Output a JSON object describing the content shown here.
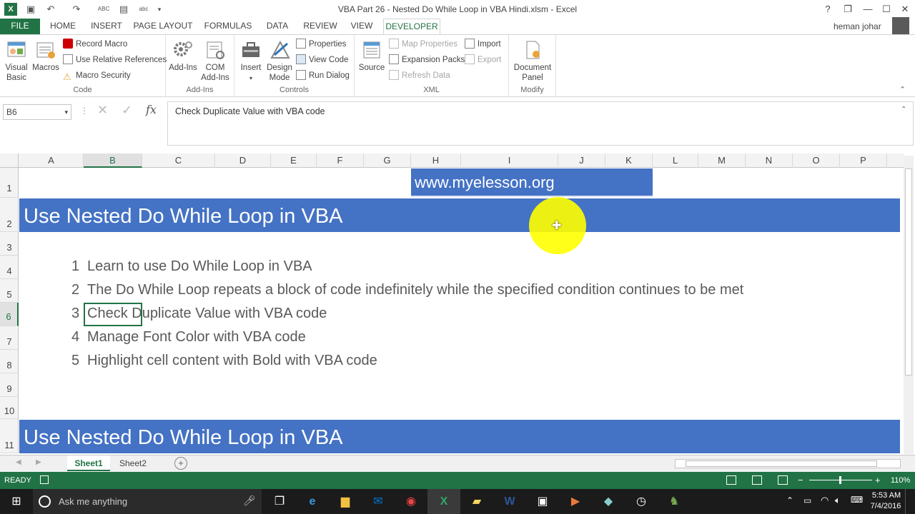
{
  "window": {
    "title": "VBA Part 26 -  Nested Do While Loop in VBA Hindi.xlsm - Excel",
    "help": "?",
    "restore": "❐",
    "minimize": "—",
    "maximize": "☐",
    "close": "✕",
    "user": "heman johar"
  },
  "ribbon_tabs": [
    {
      "label": "FILE"
    },
    {
      "label": "HOME"
    },
    {
      "label": "INSERT"
    },
    {
      "label": "PAGE LAYOUT"
    },
    {
      "label": "FORMULAS"
    },
    {
      "label": "DATA"
    },
    {
      "label": "REVIEW"
    },
    {
      "label": "VIEW"
    },
    {
      "label": "DEVELOPER"
    }
  ],
  "ribbon": {
    "code": {
      "label": "Code",
      "visual_basic": "Visual\nBasic",
      "macros": "Macros",
      "record_macro": "Record Macro",
      "relative_refs": "Use Relative References",
      "macro_security": "Macro Security"
    },
    "addins": {
      "label": "Add-Ins",
      "add_ins": "Add-Ins",
      "com_add_ins": "COM\nAdd-Ins"
    },
    "controls": {
      "label": "Controls",
      "insert": "Insert",
      "design_mode": "Design\nMode",
      "properties": "Properties",
      "view_code": "View Code",
      "run_dialog": "Run Dialog"
    },
    "xml": {
      "label": "XML",
      "source": "Source",
      "map_properties": "Map Properties",
      "expansion_packs": "Expansion Packs",
      "refresh_data": "Refresh Data",
      "import": "Import",
      "export": "Export"
    },
    "modify": {
      "label": "Modify",
      "document_panel": "Document\nPanel"
    }
  },
  "formula_bar": {
    "name_box": "B6",
    "fx": "fx",
    "value": "Check Duplicate Value with VBA code"
  },
  "columns": [
    "A",
    "B",
    "C",
    "D",
    "E",
    "F",
    "G",
    "H",
    "I",
    "J",
    "K",
    "L",
    "M",
    "N",
    "O",
    "P"
  ],
  "rows": [
    "1",
    "2",
    "3",
    "4",
    "5",
    "6",
    "7",
    "8",
    "9",
    "10",
    "11"
  ],
  "cells": {
    "url": "www.myelesson.org",
    "banner": "Use Nested Do While Loop in VBA",
    "banner2": "Use Nested Do While Loop in VBA",
    "list": [
      {
        "num": "1",
        "text": "Learn to use Do While Loop in VBA"
      },
      {
        "num": "2",
        "text": "The Do While Loop repeats a block of code indefinitely while the specified condition continues to be met"
      },
      {
        "num": "3",
        "text": "Check Duplicate Value with VBA code"
      },
      {
        "num": "4",
        "text": "Manage Font Color with VBA code"
      },
      {
        "num": "5",
        "text": "Highlight cell content with Bold with VBA code"
      }
    ]
  },
  "sheets": [
    "Sheet1",
    "Sheet2"
  ],
  "status": {
    "mode": "READY",
    "zoom": "110%"
  },
  "taskbar": {
    "search": "Ask me anything",
    "time": "5:53 AM",
    "date": "7/4/2016"
  },
  "colors": {
    "excel_green": "#217346",
    "banner_blue": "#4472c4",
    "highlight": "#ffff00"
  }
}
